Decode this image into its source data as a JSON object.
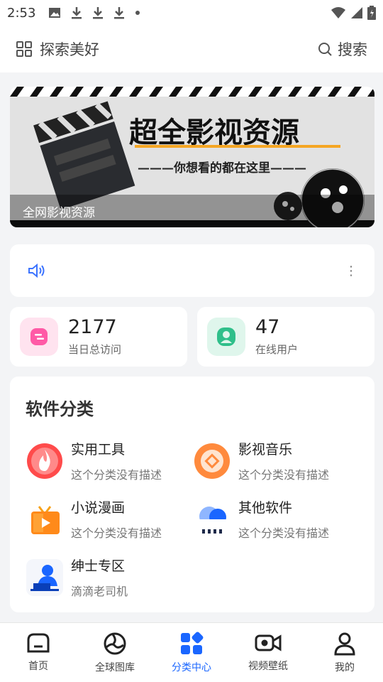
{
  "status_bar": {
    "time": "2:53"
  },
  "header": {
    "brand": "探索美好",
    "search_label": "搜索"
  },
  "banner": {
    "headline": "超全影视资源",
    "tagline": "———你想看的都在这里———",
    "caption": "全网影视资源"
  },
  "notice": {
    "text": "",
    "more": "⋮"
  },
  "stats": [
    {
      "value": "2177",
      "label": "当日总访问",
      "accent": "#ff5aa6"
    },
    {
      "value": "47",
      "label": "在线用户",
      "accent": "#2fbf8a"
    }
  ],
  "categories": {
    "title": "软件分类",
    "items": [
      {
        "name": "实用工具",
        "desc": "这个分类没有描述"
      },
      {
        "name": "影视音乐",
        "desc": "这个分类没有描述"
      },
      {
        "name": "小说漫画",
        "desc": "这个分类没有描述"
      },
      {
        "name": "其他软件",
        "desc": "这个分类没有描述"
      },
      {
        "name": "绅士专区",
        "desc": "滴滴老司机"
      }
    ]
  },
  "tabbar": {
    "items": [
      {
        "label": "首页"
      },
      {
        "label": "全球图库"
      },
      {
        "label": "分类中心"
      },
      {
        "label": "视频壁纸"
      },
      {
        "label": "我的"
      }
    ],
    "active_color": "#1a66ff"
  }
}
